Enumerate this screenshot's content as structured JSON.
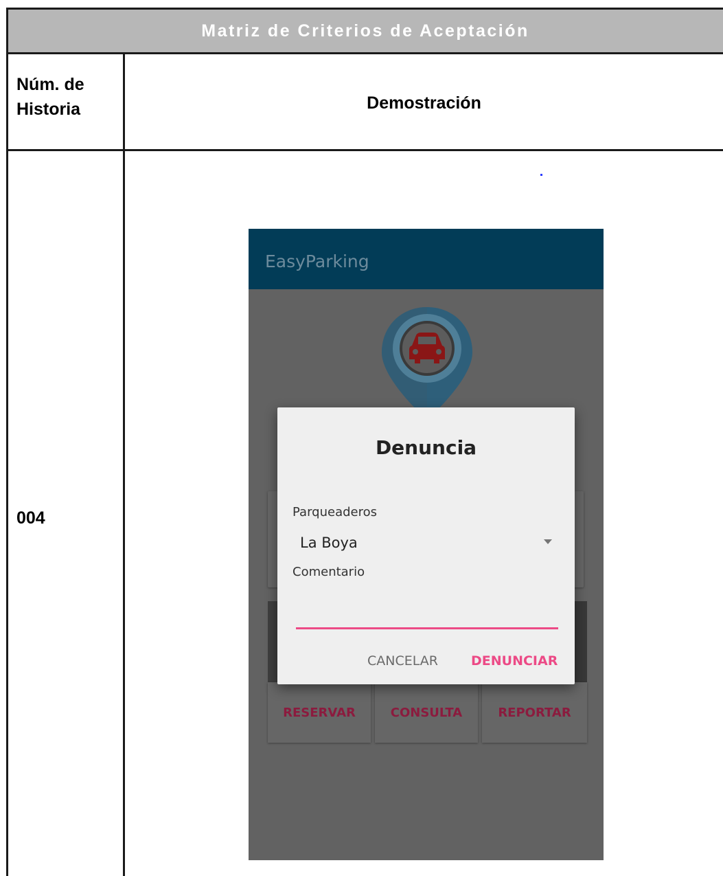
{
  "table": {
    "title": "Matriz de Criterios de Aceptación",
    "header": {
      "col1": "Núm. de Historia",
      "col2": "Demostración"
    },
    "rows": [
      {
        "id": "004"
      }
    ]
  },
  "app": {
    "title": "EasyParking",
    "dialog": {
      "title": "Denuncia",
      "parking_label": "Parqueaderos",
      "parking_value": "La Boya",
      "comment_label": "Comentario",
      "comment_value": "",
      "cancel_label": "CANCELAR",
      "submit_label": "DENUNCIAR"
    },
    "menu": {
      "reservar": "RESERVAR",
      "consulta": "CONSULTA",
      "reportar": "REPORTAR"
    },
    "icons": [
      "location-pin-icon",
      "car-icon",
      "dropdown-arrow-icon"
    ],
    "colors": {
      "appbar": "#023c57",
      "accent": "#ec4a86",
      "menu_text": "#8b1b3e",
      "pin": "#5590b0",
      "car": "#c9201f"
    }
  }
}
